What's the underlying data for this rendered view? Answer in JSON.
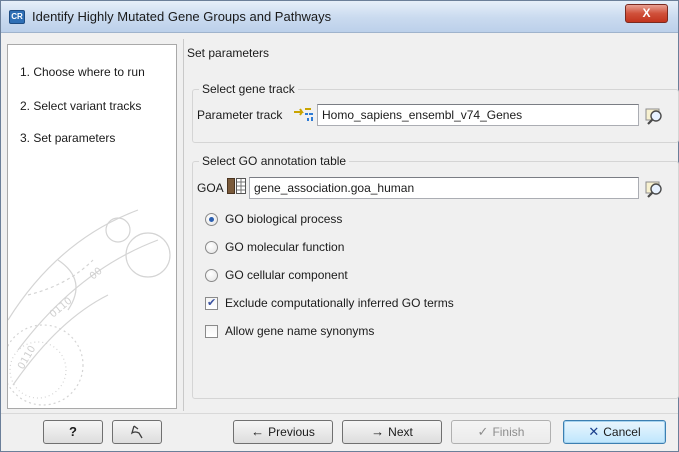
{
  "window": {
    "app_icon_text": "CR",
    "title": "Identify Highly Mutated Gene Groups and Pathways",
    "close_glyph": "X"
  },
  "steps": [
    {
      "label": "1.  Choose where to run"
    },
    {
      "label": "2.  Select variant tracks"
    },
    {
      "label": "3.  Set parameters"
    }
  ],
  "content": {
    "section_title": "Set parameters",
    "gene_track": {
      "group_title": "Select gene track",
      "label": "Parameter track",
      "value": "Homo_sapiens_ensembl_v74_Genes",
      "icon": "gene-track-icon"
    },
    "go_table": {
      "group_title": "Select GO annotation table",
      "label": "GOA",
      "value": "gene_association.goa_human",
      "icon": "table-icon"
    },
    "options": {
      "radios": [
        {
          "label": "GO biological process",
          "checked": true
        },
        {
          "label": "GO molecular function",
          "checked": false
        },
        {
          "label": "GO cellular component",
          "checked": false
        }
      ],
      "checkboxes": [
        {
          "label": "Exclude computationally inferred GO terms",
          "checked": true
        },
        {
          "label": "Allow gene name synonyms",
          "checked": false
        }
      ]
    }
  },
  "buttons": {
    "help": "?",
    "reset_icon": "reset-icon",
    "previous": "Previous",
    "next": "Next",
    "finish": "Finish",
    "cancel": "Cancel"
  },
  "colors": {
    "accent": "#2f6fb5",
    "close": "#c2341e",
    "default_button": "#bee6fd"
  }
}
